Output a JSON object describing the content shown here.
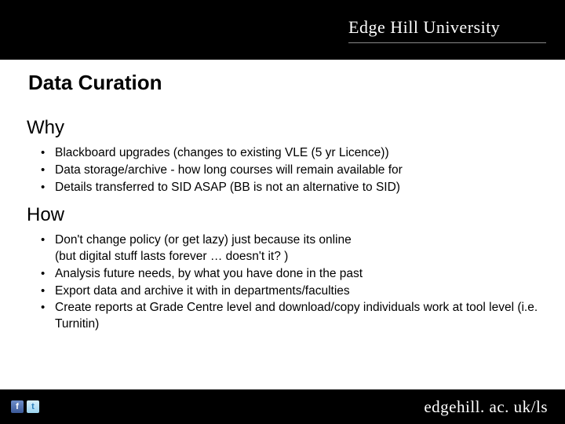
{
  "brand": "Edge Hill University",
  "title": "Data Curation",
  "sections": [
    {
      "heading": "Why",
      "items": [
        "Blackboard upgrades (changes to existing VLE (5 yr Licence))",
        "Data storage/archive - how long courses will remain available for",
        "Details transferred to SID ASAP (BB is not an alternative to SID)"
      ]
    },
    {
      "heading": "How",
      "items": [
        "Don't change policy (or get lazy) just because its online\n(but digital stuff lasts forever … doesn't it? )",
        "Analysis future needs, by what you have done in the past",
        "Export data and archive it with in departments/faculties",
        "Create reports at Grade Centre level and download/copy individuals work at tool level (i.e. Turnitin)"
      ]
    }
  ],
  "footer_url": "edgehill. ac. uk/ls",
  "icons": {
    "facebook": "f",
    "twitter": "t"
  }
}
